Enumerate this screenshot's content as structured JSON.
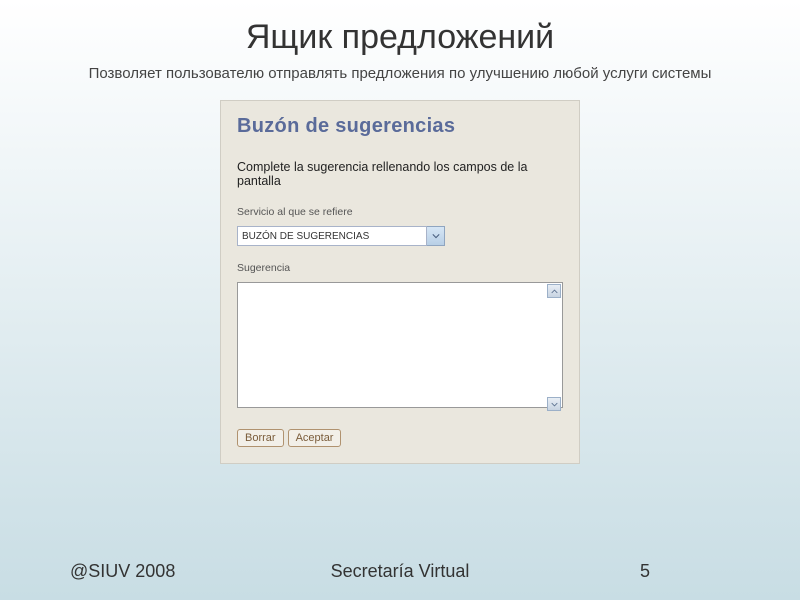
{
  "slide": {
    "title": "Ящик предложений",
    "subtitle": "Позволяет пользователю отправлять предложения по улучшению любой услуги системы"
  },
  "form": {
    "heading": "Buzón de sugerencias",
    "instruction": "Complete la sugerencia rellenando los campos de la pantalla",
    "service_label": "Servicio al que se refiere",
    "service_selected": "BUZÓN DE SUGERENCIAS",
    "suggestion_label": "Sugerencia",
    "suggestion_value": "",
    "clear_label": "Borrar",
    "accept_label": "Aceptar"
  },
  "footer": {
    "handle": "@SIUV 2008",
    "center": "Secretaría Virtual",
    "page": "5"
  }
}
